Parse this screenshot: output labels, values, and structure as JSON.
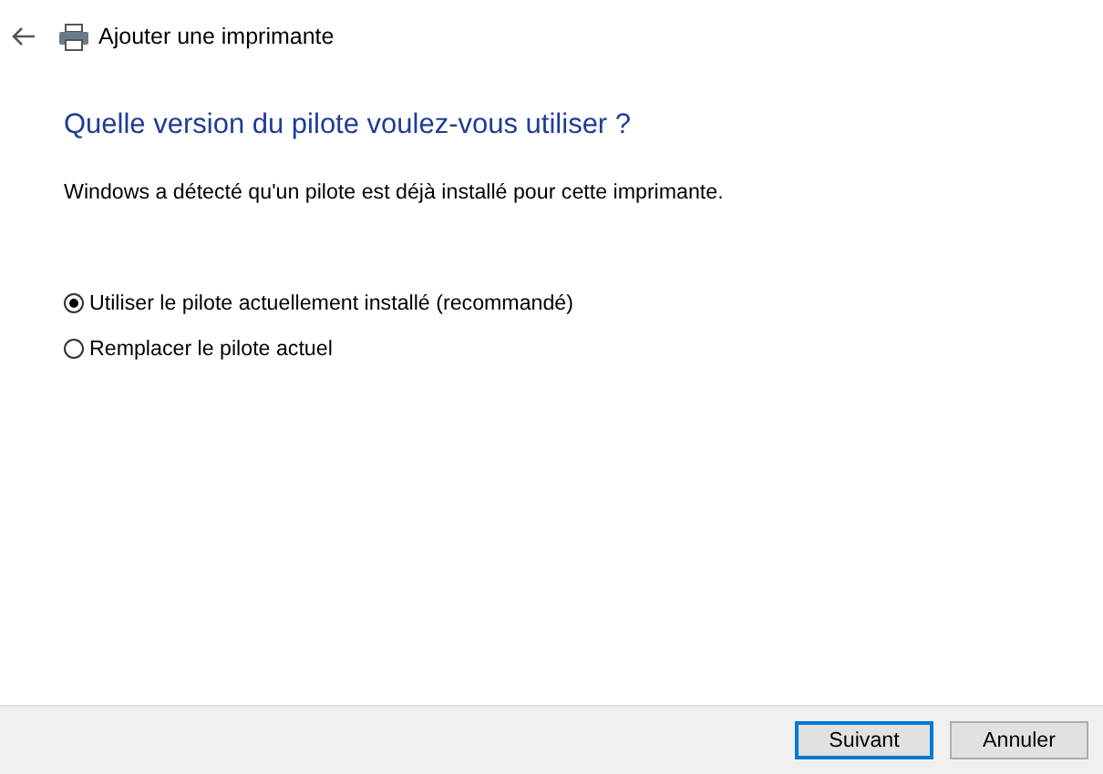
{
  "window": {
    "title": "Ajouter une imprimante"
  },
  "heading": "Quelle version du pilote voulez-vous utiliser ?",
  "description": "Windows a détecté qu'un pilote est déjà installé pour cette imprimante.",
  "options": [
    {
      "label": "Utiliser le pilote actuellement installé (recommandé)",
      "selected": true
    },
    {
      "label": "Remplacer le pilote actuel",
      "selected": false
    }
  ],
  "buttons": [
    {
      "label": "Suivant",
      "focused": true
    },
    {
      "label": "Annuler",
      "focused": false
    }
  ]
}
